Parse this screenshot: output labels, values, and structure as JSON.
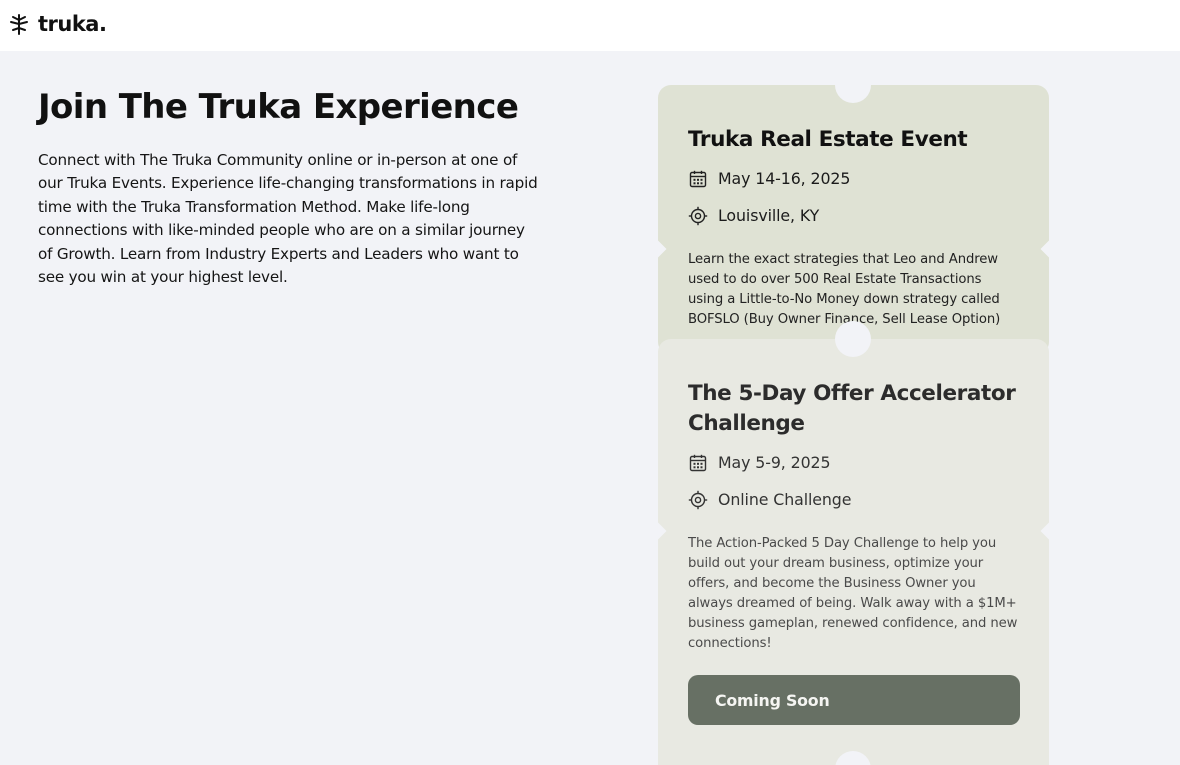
{
  "header": {
    "logo_text": "truka.",
    "logo_icon": "tree-icon"
  },
  "intro": {
    "title": "Join The Truka Experience",
    "description": "Connect with The Truka Community online or in-person at one of our Truka Events. Experience life-changing transformations in rapid time with the Truka Transformation Method. Make life-long connections with like-minded people who are on a similar journey of Growth. Learn from Industry Experts and Leaders who want to see you win at your highest level."
  },
  "events": [
    {
      "title": "Truka Real Estate Event",
      "date": "May 14-16, 2025",
      "location": "Louisville, KY",
      "description": "Learn the exact strategies that Leo and Andrew used to do over 500 Real Estate Transactions using a Little-to-No Money down strategy called BOFSLO (Buy Owner Finance, Sell Lease Option)",
      "card_color": "#dfe2d4"
    },
    {
      "title": "The 5-Day Offer Accelerator Challenge",
      "date": "May 5-9, 2025",
      "location": "Online Challenge",
      "description": "The Action-Packed 5 Day Challenge to help you build out your dream business, optimize your offers, and become the Business Owner you always dreamed of being. Walk away with a $1M+ business gameplan, renewed confidence, and new connections!",
      "button_label": "Coming Soon",
      "card_color": "#e8e9e2"
    }
  ],
  "colors": {
    "page_background": "#f2f3f7",
    "button_background": "#677064"
  }
}
